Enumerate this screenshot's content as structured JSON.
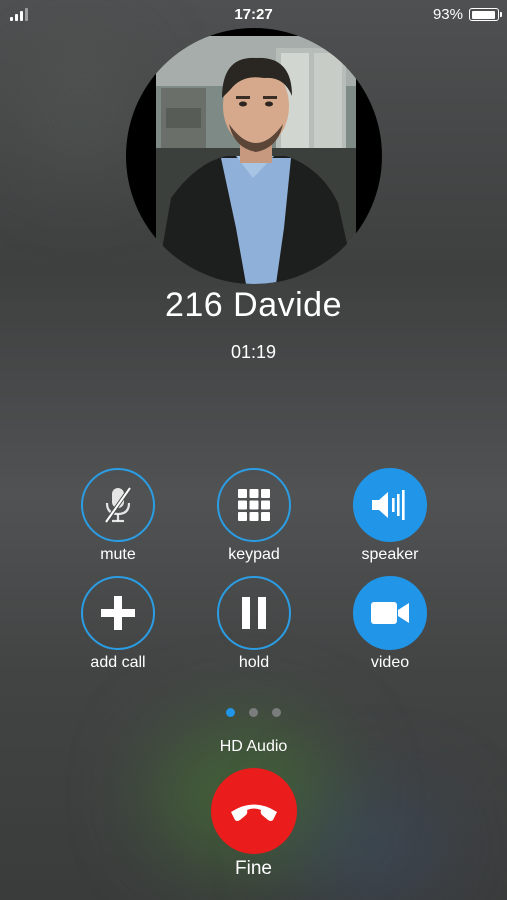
{
  "status_bar": {
    "time": "17:27",
    "battery": "93%",
    "battery_level": 0.93
  },
  "call": {
    "caller_name": "216 Davide",
    "duration": "01:19"
  },
  "controls": [
    {
      "id": "mute",
      "label": "mute",
      "icon": "microphone-off-icon"
    },
    {
      "id": "keypad",
      "label": "keypad",
      "icon": "keypad-grid-icon"
    },
    {
      "id": "speaker",
      "label": "speaker",
      "icon": "speaker-icon",
      "active": true
    },
    {
      "id": "add-call",
      "label": "add call",
      "icon": "plus-icon"
    },
    {
      "id": "hold",
      "label": "hold",
      "icon": "pause-icon"
    },
    {
      "id": "video",
      "label": "video",
      "icon": "video-camera-icon",
      "active": true
    }
  ],
  "pager": {
    "count": 3,
    "active": 1
  },
  "audio_quality": "HD Audio",
  "end_call": {
    "label": "Fine",
    "icon": "hang-up-phone-icon",
    "color": "#ea1c1c"
  },
  "colors": {
    "accent": "#2196e8",
    "end_call": "#ea1c1c"
  }
}
